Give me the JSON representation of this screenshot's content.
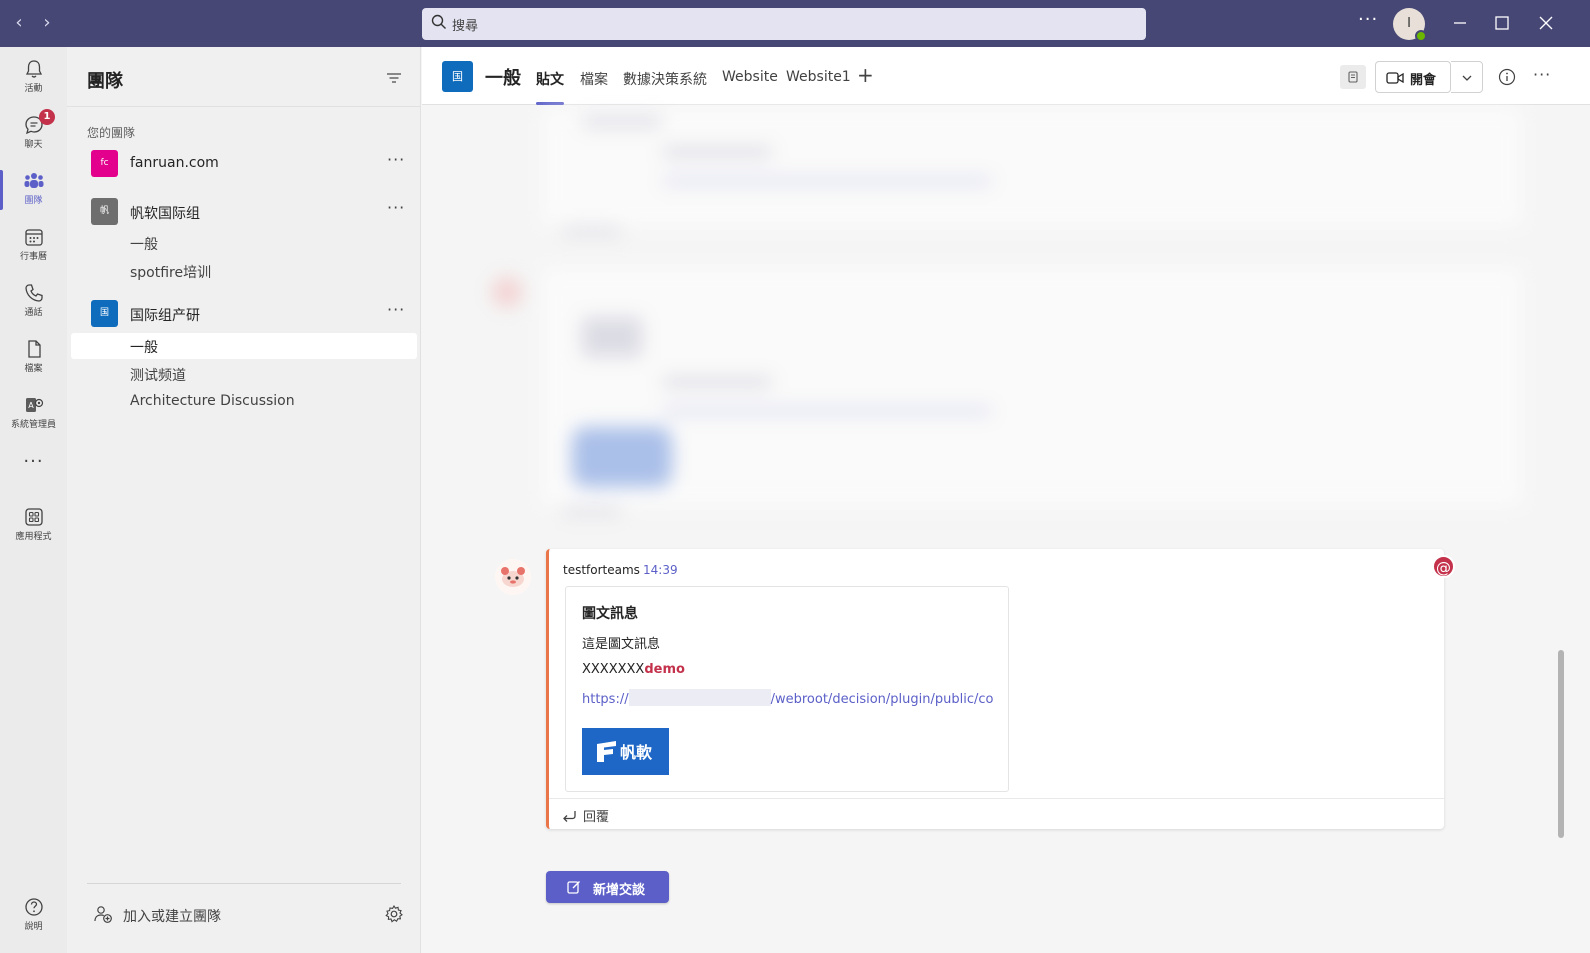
{
  "titlebar": {
    "search_placeholder": "搜尋",
    "more": "···",
    "avatar_initial": "I"
  },
  "rail": {
    "items": [
      {
        "label": "活動",
        "icon": "bell-icon"
      },
      {
        "label": "聊天",
        "icon": "chat-icon",
        "badge": "1"
      },
      {
        "label": "團隊",
        "icon": "teams-icon"
      },
      {
        "label": "行事曆",
        "icon": "calendar-icon"
      },
      {
        "label": "通話",
        "icon": "phone-icon"
      },
      {
        "label": "檔案",
        "icon": "file-icon"
      },
      {
        "label": "系統管理員",
        "icon": "admin-icon"
      },
      {
        "label": "應用程式",
        "icon": "apps-icon"
      },
      {
        "label": "說明",
        "icon": "help-icon"
      }
    ],
    "more": "···"
  },
  "panel": {
    "title": "團隊",
    "section_label": "您的團隊",
    "teams": [
      {
        "name": "fanruan.com",
        "tile": "fc",
        "color": "#e3008c",
        "channels": []
      },
      {
        "name": "帆软国际组",
        "tile": "帆",
        "color": "#6e6e6e",
        "channels": [
          "一般",
          "spotfire培训"
        ]
      },
      {
        "name": "国际组产研",
        "tile": "国",
        "color": "#0f6cbd",
        "channels": [
          "一般",
          "测试频道",
          "Architecture Discussion"
        ]
      }
    ],
    "team_more": "···",
    "join_label": "加入或建立團隊"
  },
  "channel_header": {
    "tile": "国",
    "title": "一般",
    "tabs": [
      "貼文",
      "檔案",
      "數據決策系統",
      "Website",
      "Website1"
    ],
    "add_tab": "+",
    "meet_label": "開會",
    "more": "···"
  },
  "message": {
    "author": "testforteams",
    "time": "14:39",
    "mention": "@",
    "card": {
      "title": "圖文訊息",
      "text": "這是圖文訊息",
      "x_prefix": "XXXXXXX",
      "x_bold": "demo",
      "link_prefix": "https://",
      "link_suffix": "/webroot/decision/plugin/public/cor",
      "logo_text": "帆軟"
    },
    "reply_label": "回覆"
  },
  "new_conversation_label": "新增交談",
  "colors": {
    "titlebar": "#464775",
    "accent": "#5b5fc7",
    "mention": "#c4314b",
    "card_border": "#e97548"
  }
}
